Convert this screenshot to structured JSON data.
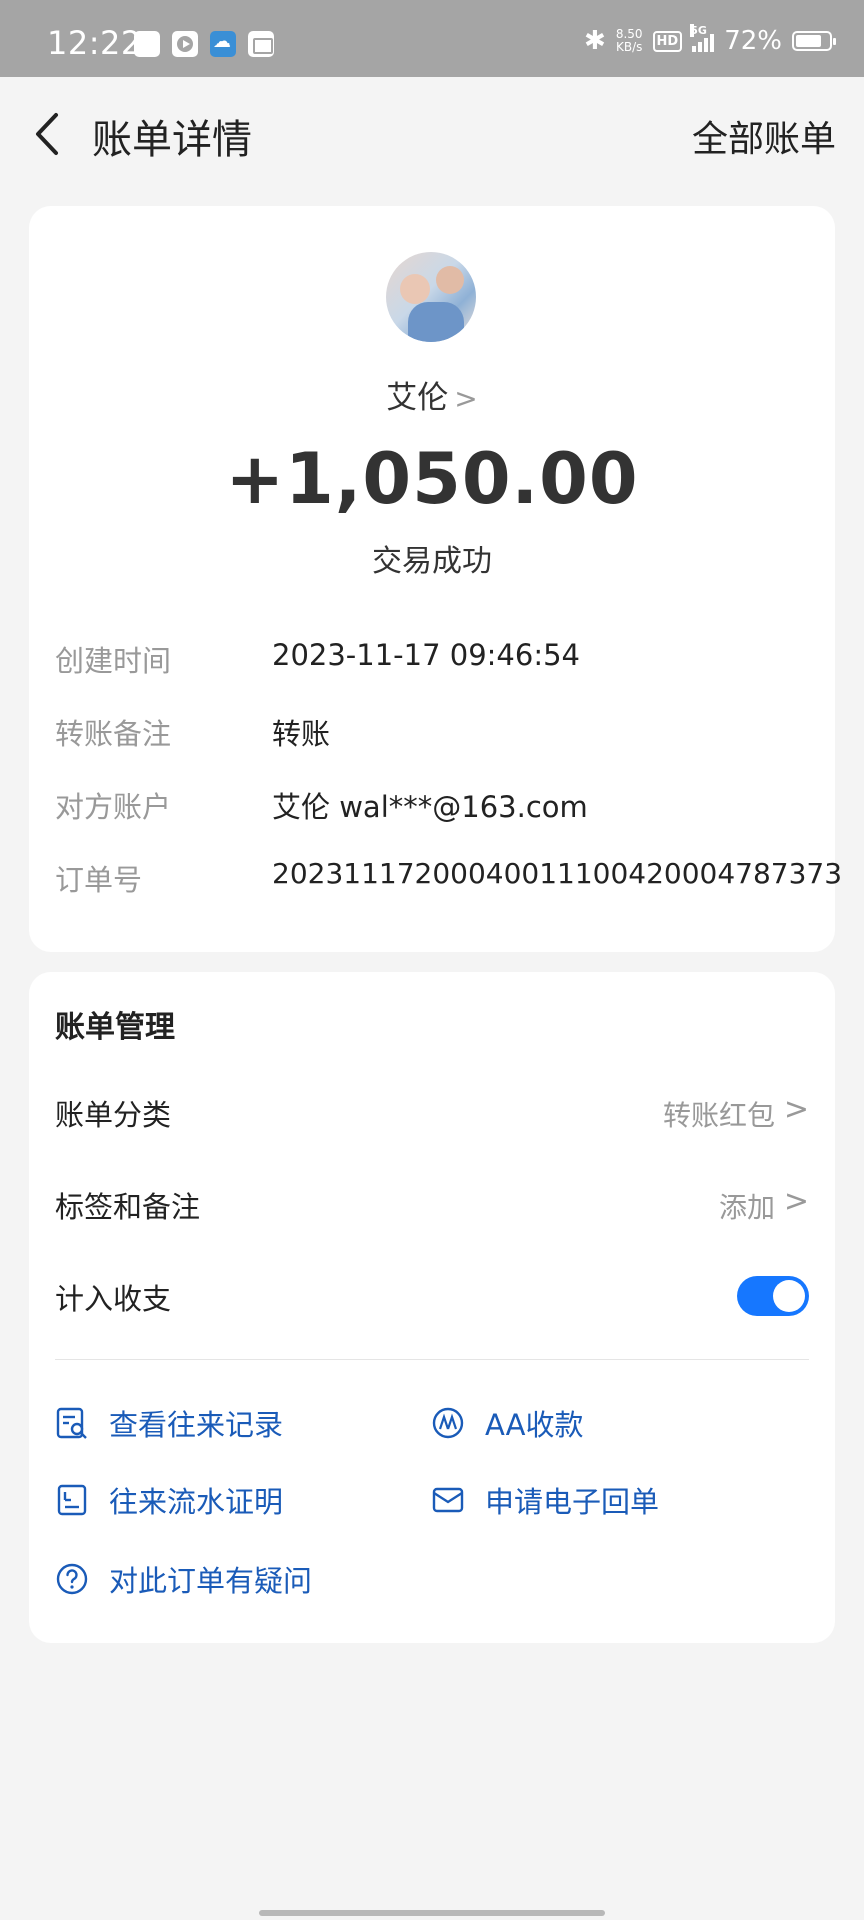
{
  "status_bar": {
    "time": "12:22",
    "net_speed_value": "8.50",
    "net_speed_unit": "KB/s",
    "hd": "HD",
    "network": "5G",
    "battery": "72%"
  },
  "header": {
    "title": "账单详情",
    "right_action": "全部账单"
  },
  "transaction": {
    "counterparty": "艾伦",
    "amount": "+1,050.00",
    "status": "交易成功"
  },
  "details": [
    {
      "label": "创建时间",
      "value": "2023-11-17 09:46:54"
    },
    {
      "label": "转账备注",
      "value": "转账"
    },
    {
      "label": "对方账户",
      "value": "艾伦 wal***@163.com"
    },
    {
      "label": "订单号",
      "value": "20231117200040011100420004787373"
    }
  ],
  "manage": {
    "title": "账单管理",
    "category_label": "账单分类",
    "category_value": "转账红包",
    "tags_label": "标签和备注",
    "tags_value": "添加",
    "include_label": "计入收支",
    "include_enabled": true
  },
  "actions": {
    "history": "查看往来记录",
    "aa": "AA收款",
    "statement": "往来流水证明",
    "receipt": "申请电子回单",
    "question": "对此订单有疑问"
  },
  "colors": {
    "accent": "#1677ff",
    "link": "#1a5bb8",
    "muted": "#999999",
    "background": "#f4f4f4"
  }
}
